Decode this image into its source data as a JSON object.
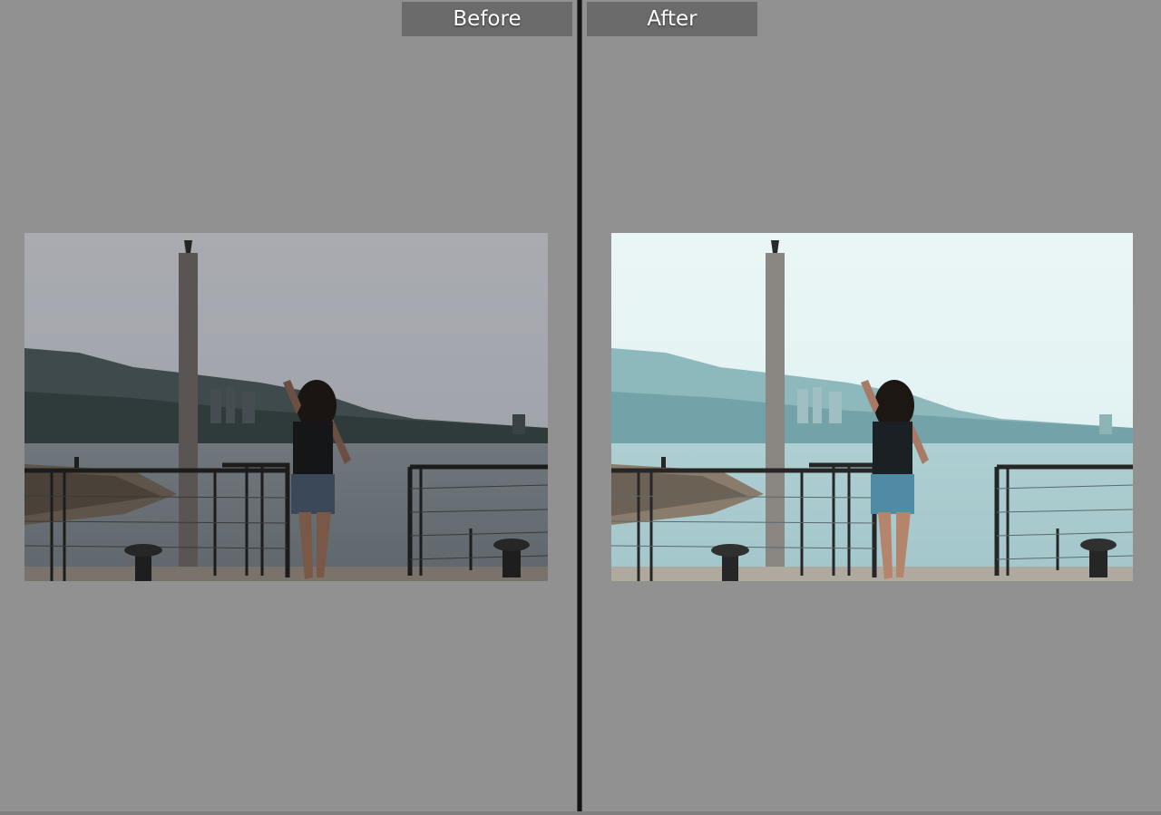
{
  "compare": {
    "before_label": "Before",
    "after_label": "After"
  },
  "colors": {
    "background": "#919191",
    "divider": "#141414",
    "label_bg": "#6b6b6b",
    "label_text": "#ffffff"
  }
}
